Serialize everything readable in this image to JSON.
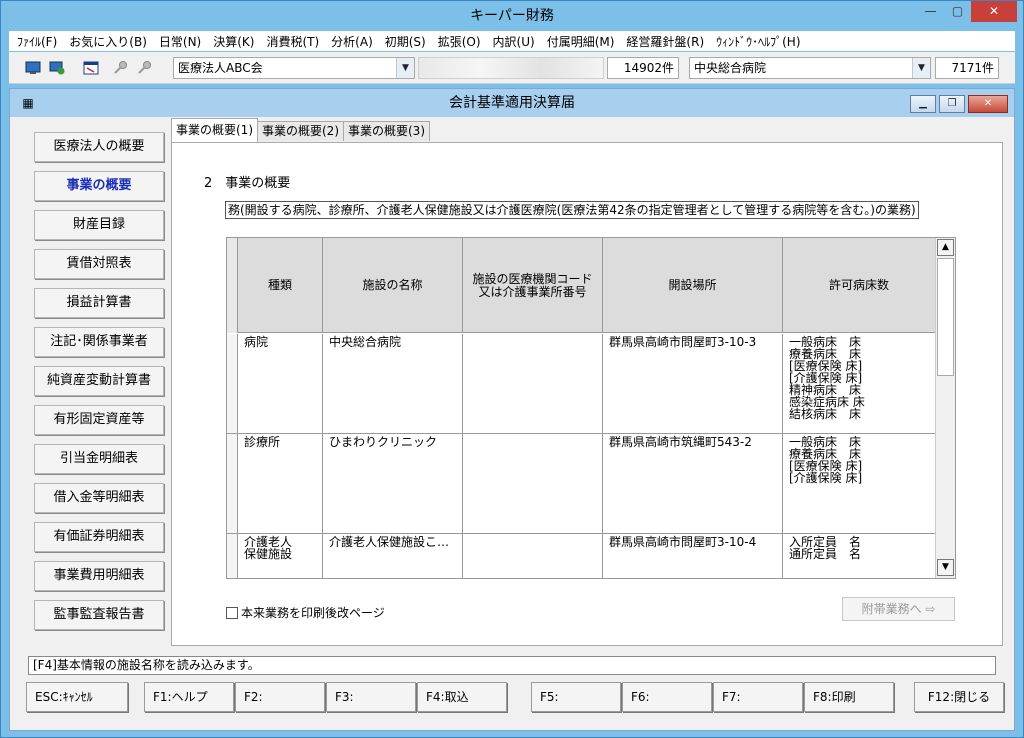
{
  "window": {
    "title": "キーパー財務"
  },
  "menu": [
    "ﾌｧｲﾙ(F)",
    "お気に入り(B)",
    "日常(N)",
    "決算(K)",
    "消費税(T)",
    "分析(A)",
    "初期(S)",
    "拡張(O)",
    "内訳(U)",
    "付属明細(M)",
    "経営羅針盤(R)",
    "ｳｨﾝﾄﾞｳ･ﾍﾙﾌﾟ(H)"
  ],
  "toolbar": {
    "corp_combo": "医療法人ABC会",
    "count1": "14902件",
    "facility_combo": "中央総合病院",
    "count2": "7171件"
  },
  "inner": {
    "title": "会計基準適用決算届"
  },
  "sidebar": [
    "医療法人の概要",
    "事業の概要",
    "財産目録",
    "賃借対照表",
    "損益計算書",
    "注記･関係事業者",
    "純資産変動計算書",
    "有形固定資産等",
    "引当金明細表",
    "借入金等明細表",
    "有価証券明細表",
    "事業費用明細表",
    "監事監査報告書"
  ],
  "tabs": [
    "事業の概要(1)",
    "事業の概要(2)",
    "事業の概要(3)"
  ],
  "section": {
    "title": "2　事業の概要",
    "subtitle": "務(開設する病院、診療所、介護老人保健施設又は介護医療院(医療法第42条の指定管理者として管理する病院等を含む。)の業務)"
  },
  "table": {
    "headers": [
      "種類",
      "施設の名称",
      "施設の医療機関コード\n又は介護事業所番号",
      "開設場所",
      "許可病床数"
    ],
    "rows": [
      {
        "kind": "病院",
        "name": "中央総合病院",
        "code": "",
        "place": "群馬県高崎市問屋町3-10-3",
        "beds": "一般病床　床\n療養病床　床\n[医療保険 床]\n[介護保険 床]\n精神病床　床\n感染症病床 床\n結核病床　床"
      },
      {
        "kind": "診療所",
        "name": "ひまわりクリニック",
        "code": "",
        "place": "群馬県高崎市筑縄町543-2",
        "beds": "一般病床　床\n療養病床　床\n[医療保険 床]\n[介護保険 床]"
      },
      {
        "kind": "介護老人\n保健施設",
        "name": "介護老人保健施設こ…",
        "code": "",
        "place": "群馬県高崎市問屋町3-10-4",
        "beds": "入所定員　名\n通所定員　名"
      }
    ]
  },
  "checkbox_label": "本来業務を印刷後改ページ",
  "fuki_button": "附帯業務へ ⇨",
  "status": "[F4]基本情報の施設名称を読み込みます。",
  "fkeys": [
    "ESC:ｷｬﾝｾﾙ",
    "F1:ヘルプ",
    "F2:",
    "F3:",
    "F4:取込",
    "F5:",
    "F6:",
    "F7:",
    "F8:印刷",
    "F12:閉じる"
  ]
}
